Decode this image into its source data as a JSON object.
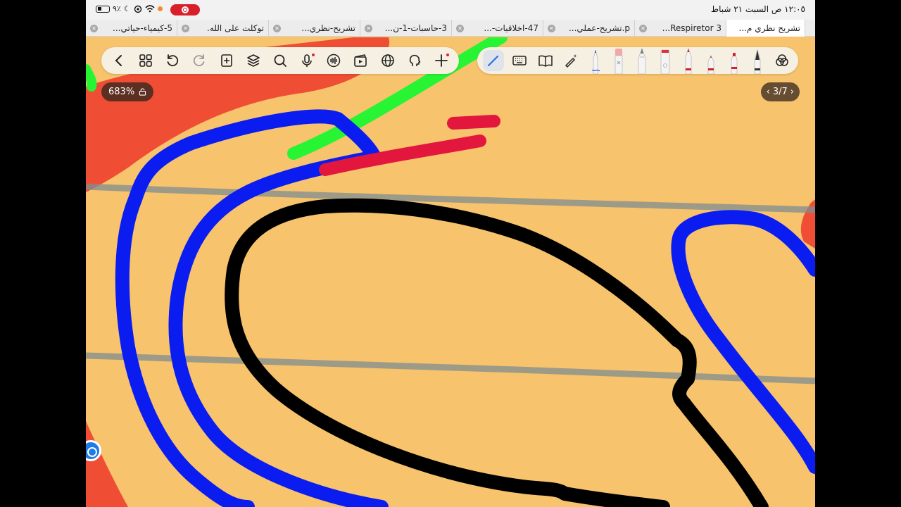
{
  "status_bar": {
    "battery_percent": "٩٪",
    "clock": "١٢:٠٥ ص  السبت ٢١ شباط"
  },
  "tabs": [
    {
      "label": "5-كيمياء-حياتي..."
    },
    {
      "label": "توكلت على الله."
    },
    {
      "label": "تشريح-نظري..."
    },
    {
      "label": "3-حاسبات-1-ن..."
    },
    {
      "label": "47-اخلاقيات-..."
    },
    {
      "label": "p.تشريح-عملي..."
    },
    {
      "label": "3 Respiretor..."
    },
    {
      "label": "تشريح نظري م..."
    }
  ],
  "active_tab_index": 7,
  "left_toolbar": {
    "items": [
      {
        "icon": "back-chevron-icon"
      },
      {
        "icon": "grid-icon"
      },
      {
        "icon": "undo-icon"
      },
      {
        "icon": "redo-icon"
      },
      {
        "icon": "add-page-icon"
      },
      {
        "icon": "layers-icon"
      },
      {
        "icon": "search-icon"
      },
      {
        "icon": "microphone-icon"
      },
      {
        "icon": "audio-wave-icon"
      },
      {
        "icon": "media-icon"
      },
      {
        "icon": "globe-icon"
      },
      {
        "icon": "ai-head-icon"
      },
      {
        "icon": "plus-icon"
      }
    ]
  },
  "right_toolbar": {
    "items": [
      {
        "icon": "pen-selected-icon"
      },
      {
        "icon": "keyboard-icon"
      },
      {
        "icon": "book-icon"
      },
      {
        "icon": "magic-pen-icon"
      },
      {
        "icon": "blue-pen-tool"
      },
      {
        "icon": "eraser-tool"
      },
      {
        "icon": "pencil-tool"
      },
      {
        "icon": "highlighter-tool"
      },
      {
        "icon": "red-marker-tool"
      },
      {
        "icon": "red-fineliner-tool"
      },
      {
        "icon": "red-brush-tool"
      },
      {
        "icon": "fountain-pen-tool"
      },
      {
        "icon": "color-palette-icon"
      }
    ]
  },
  "zoom": {
    "label": "683%"
  },
  "page": {
    "label": "3/7"
  },
  "colors": {
    "page_background": "#f7c36c",
    "ink_blue": "#0a1cf0",
    "ink_black": "#000000",
    "ink_red": "#e3173e",
    "ink_green": "#27f533",
    "highlight_red": "#ef4e35",
    "ruled_line": "#7f8e92"
  }
}
